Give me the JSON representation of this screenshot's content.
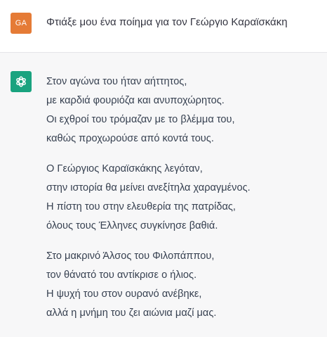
{
  "user": {
    "avatar_initials": "GA",
    "avatar_color": "#e57b36",
    "message": "Φτιάξε μου ένα ποίημα για τον Γεώργιο Καραϊσκάκη"
  },
  "assistant": {
    "avatar_icon": "openai-logo-icon",
    "avatar_color": "#19a37f",
    "stanzas": [
      {
        "lines": [
          "Στον αγώνα του ήταν αήττητος,",
          "με καρδιά φουριόζα και ανυποχώρητος.",
          "Οι εχθροί του τρόμαζαν με το βλέμμα του,",
          "καθώς προχωρούσε από κοντά τους."
        ]
      },
      {
        "lines": [
          "Ο Γεώργιος Καραϊσκάκης λεγόταν,",
          "στην ιστορία θα μείνει ανεξίτηλα χαραγμένος.",
          "Η πίστη του στην ελευθερία της πατρίδας,",
          "όλους τους Έλληνες συγκίνησε βαθιά."
        ]
      },
      {
        "lines": [
          "Στο μακρινό Άλσος του Φιλοπάππου,",
          "τον θάνατό του αντίκρισε ο ήλιος.",
          "Η ψυχή του στον ουρανό ανέβηκε,",
          "αλλά η μνήμη του ζει αιώνια μαζί μας."
        ]
      }
    ]
  }
}
